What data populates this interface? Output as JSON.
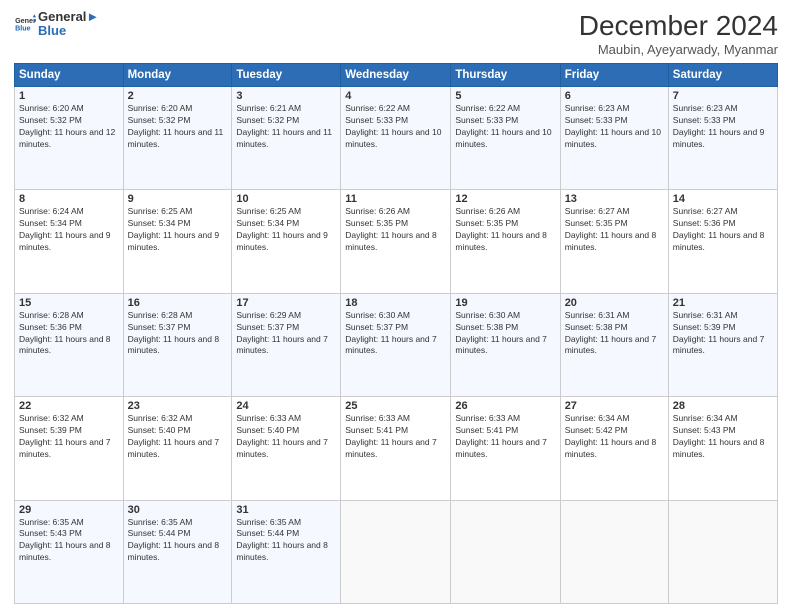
{
  "header": {
    "logo_line1": "General",
    "logo_line2": "Blue",
    "month_title": "December 2024",
    "subtitle": "Maubin, Ayeyarwady, Myanmar"
  },
  "weekdays": [
    "Sunday",
    "Monday",
    "Tuesday",
    "Wednesday",
    "Thursday",
    "Friday",
    "Saturday"
  ],
  "weeks": [
    [
      {
        "day": "1",
        "sunrise": "6:20 AM",
        "sunset": "5:32 PM",
        "daylight": "11 hours and 12 minutes."
      },
      {
        "day": "2",
        "sunrise": "6:20 AM",
        "sunset": "5:32 PM",
        "daylight": "11 hours and 11 minutes."
      },
      {
        "day": "3",
        "sunrise": "6:21 AM",
        "sunset": "5:32 PM",
        "daylight": "11 hours and 11 minutes."
      },
      {
        "day": "4",
        "sunrise": "6:22 AM",
        "sunset": "5:33 PM",
        "daylight": "11 hours and 10 minutes."
      },
      {
        "day": "5",
        "sunrise": "6:22 AM",
        "sunset": "5:33 PM",
        "daylight": "11 hours and 10 minutes."
      },
      {
        "day": "6",
        "sunrise": "6:23 AM",
        "sunset": "5:33 PM",
        "daylight": "11 hours and 10 minutes."
      },
      {
        "day": "7",
        "sunrise": "6:23 AM",
        "sunset": "5:33 PM",
        "daylight": "11 hours and 9 minutes."
      }
    ],
    [
      {
        "day": "8",
        "sunrise": "6:24 AM",
        "sunset": "5:34 PM",
        "daylight": "11 hours and 9 minutes."
      },
      {
        "day": "9",
        "sunrise": "6:25 AM",
        "sunset": "5:34 PM",
        "daylight": "11 hours and 9 minutes."
      },
      {
        "day": "10",
        "sunrise": "6:25 AM",
        "sunset": "5:34 PM",
        "daylight": "11 hours and 9 minutes."
      },
      {
        "day": "11",
        "sunrise": "6:26 AM",
        "sunset": "5:35 PM",
        "daylight": "11 hours and 8 minutes."
      },
      {
        "day": "12",
        "sunrise": "6:26 AM",
        "sunset": "5:35 PM",
        "daylight": "11 hours and 8 minutes."
      },
      {
        "day": "13",
        "sunrise": "6:27 AM",
        "sunset": "5:35 PM",
        "daylight": "11 hours and 8 minutes."
      },
      {
        "day": "14",
        "sunrise": "6:27 AM",
        "sunset": "5:36 PM",
        "daylight": "11 hours and 8 minutes."
      }
    ],
    [
      {
        "day": "15",
        "sunrise": "6:28 AM",
        "sunset": "5:36 PM",
        "daylight": "11 hours and 8 minutes."
      },
      {
        "day": "16",
        "sunrise": "6:28 AM",
        "sunset": "5:37 PM",
        "daylight": "11 hours and 8 minutes."
      },
      {
        "day": "17",
        "sunrise": "6:29 AM",
        "sunset": "5:37 PM",
        "daylight": "11 hours and 7 minutes."
      },
      {
        "day": "18",
        "sunrise": "6:30 AM",
        "sunset": "5:37 PM",
        "daylight": "11 hours and 7 minutes."
      },
      {
        "day": "19",
        "sunrise": "6:30 AM",
        "sunset": "5:38 PM",
        "daylight": "11 hours and 7 minutes."
      },
      {
        "day": "20",
        "sunrise": "6:31 AM",
        "sunset": "5:38 PM",
        "daylight": "11 hours and 7 minutes."
      },
      {
        "day": "21",
        "sunrise": "6:31 AM",
        "sunset": "5:39 PM",
        "daylight": "11 hours and 7 minutes."
      }
    ],
    [
      {
        "day": "22",
        "sunrise": "6:32 AM",
        "sunset": "5:39 PM",
        "daylight": "11 hours and 7 minutes."
      },
      {
        "day": "23",
        "sunrise": "6:32 AM",
        "sunset": "5:40 PM",
        "daylight": "11 hours and 7 minutes."
      },
      {
        "day": "24",
        "sunrise": "6:33 AM",
        "sunset": "5:40 PM",
        "daylight": "11 hours and 7 minutes."
      },
      {
        "day": "25",
        "sunrise": "6:33 AM",
        "sunset": "5:41 PM",
        "daylight": "11 hours and 7 minutes."
      },
      {
        "day": "26",
        "sunrise": "6:33 AM",
        "sunset": "5:41 PM",
        "daylight": "11 hours and 7 minutes."
      },
      {
        "day": "27",
        "sunrise": "6:34 AM",
        "sunset": "5:42 PM",
        "daylight": "11 hours and 8 minutes."
      },
      {
        "day": "28",
        "sunrise": "6:34 AM",
        "sunset": "5:43 PM",
        "daylight": "11 hours and 8 minutes."
      }
    ],
    [
      {
        "day": "29",
        "sunrise": "6:35 AM",
        "sunset": "5:43 PM",
        "daylight": "11 hours and 8 minutes."
      },
      {
        "day": "30",
        "sunrise": "6:35 AM",
        "sunset": "5:44 PM",
        "daylight": "11 hours and 8 minutes."
      },
      {
        "day": "31",
        "sunrise": "6:35 AM",
        "sunset": "5:44 PM",
        "daylight": "11 hours and 8 minutes."
      },
      null,
      null,
      null,
      null
    ]
  ],
  "labels": {
    "sunrise": "Sunrise:",
    "sunset": "Sunset:",
    "daylight": "Daylight:"
  }
}
